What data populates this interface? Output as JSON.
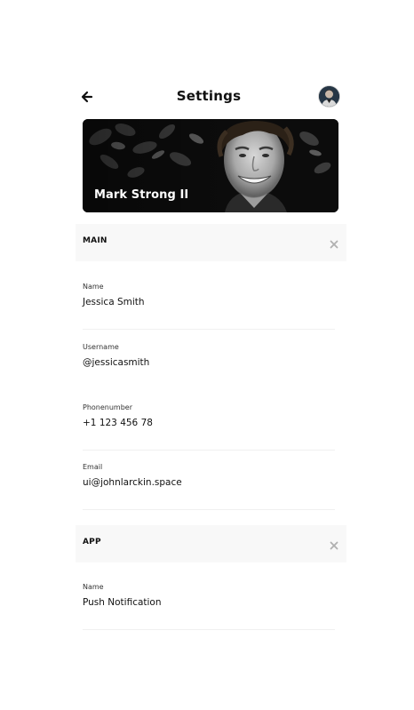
{
  "header": {
    "title": "Settings",
    "back_icon": "arrow-left-icon",
    "avatar_icon": "avatar"
  },
  "profile": {
    "name": "Mark Strong II"
  },
  "sections": [
    {
      "title": "MAIN",
      "close_icon": "close-icon",
      "fields": [
        {
          "label": "Name",
          "value": "Jessica Smith"
        },
        {
          "label": "Username",
          "value": "@jessicasmith"
        },
        {
          "label": "Phonenumber",
          "value": "+1 123 456 78"
        },
        {
          "label": "Email",
          "value": "ui@johnlarckin.space"
        }
      ]
    },
    {
      "title": "APP",
      "close_icon": "close-icon",
      "fields": [
        {
          "label": "Name",
          "value": "Push Notification"
        }
      ]
    }
  ],
  "colors": {
    "section_bg": "#f8f8f8",
    "text": "#111111",
    "close_icon": "#b0b0b0"
  }
}
